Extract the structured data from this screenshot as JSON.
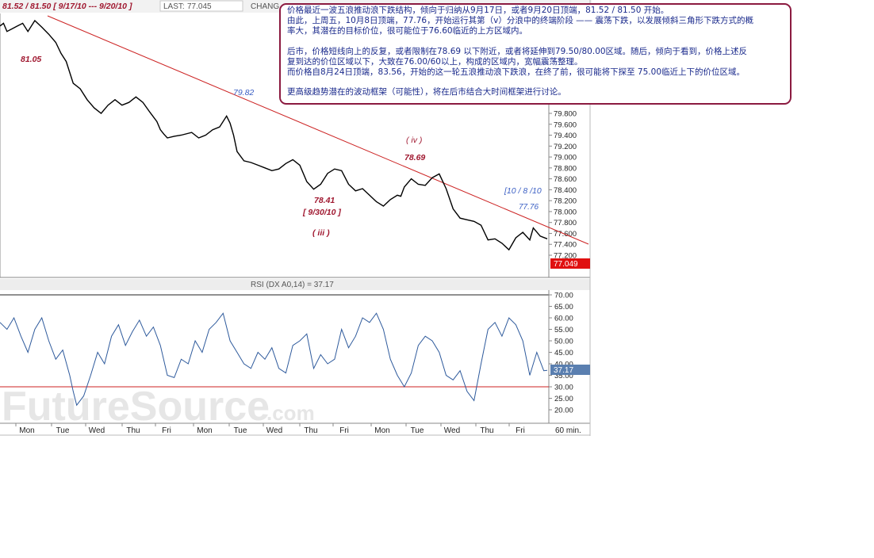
{
  "header": {
    "range_label": "81.52 / 81.50  [ 9/17/10 --- 9/20/10 ]",
    "last_label": "LAST:",
    "last_value": "77.045",
    "change_label": "CHANG"
  },
  "rsi_panel": {
    "label": "RSI (DX A0,14) = 37.17",
    "badge": "37.17"
  },
  "price_badge": "77.049",
  "watermark": {
    "main": "FutureSource",
    "suffix": ".com"
  },
  "annotations": {
    "a_81_05": "81.05",
    "a_79_82": "79.82",
    "a_iv": "( iv )",
    "a_78_69": "78.69",
    "a_78_41": "78.41",
    "a_9_30": "[ 9/30/10 ]",
    "a_iii": "( iii )",
    "a_10_8": "[10 / 8 /10",
    "a_77_76": "77.76"
  },
  "note": {
    "lines": [
      "价格最近一波五浪推动浪下跌结构，倾向于归纳从9月17日，或者9月20日顶端，81.52 / 81.50 开始。",
      "由此，上周五，10月8日顶端，77.76，开始运行其第（v）分浪中的终端阶段 —— 震荡下跌，以发展倾斜三角形下跌方式的概",
      "率大，其潜在的目标价位，很可能位于76.60临近的上方区域内。",
      "",
      "后市，价格短线向上的反复，或者限制在78.69 以下附近，或者将延伸到79.50/80.00区域。随后，倾向于看到，价格上述反",
      "复到达的价位区域以下，大致在76.00/60以上，构成的区域内，宽幅震荡整理。",
      "而价格自8月24日顶端，83.56，开始的这一轮五浪推动浪下跌浪，在终了前，很可能将下探至 75.00临近上下的价位区域。",
      "",
      "更高级趋势潜在的波动框架（可能性），将在后市结合大时间框架进行讨论。"
    ]
  },
  "colors": {
    "price_line": "#000000",
    "rsi_line": "#2e5a9c",
    "trend_line": "#cc2222",
    "rsi_ref_line": "#cc2222",
    "annotation_red": "#a01830",
    "annotation_blue": "#3b5fc4",
    "note_border": "#8b1a40",
    "note_text": "#1a2a8c",
    "price_badge_bg": "#e01010",
    "rsi_badge_bg": "#5a7fb0"
  },
  "chart_data": [
    {
      "type": "line",
      "name_hint": "price",
      "y_ticks": [
        "79.800",
        "79.600",
        "79.400",
        "79.200",
        "79.000",
        "78.800",
        "78.600",
        "78.400",
        "78.200",
        "78.000",
        "77.800",
        "77.600",
        "77.400",
        "77.200"
      ],
      "ylim": [
        77.0,
        81.6
      ],
      "x_ticks": [
        "Mon",
        "Tue",
        "Wed",
        "Thu",
        "Fri",
        "Mon",
        "Tue",
        "Wed",
        "Thu",
        "Fri",
        "Mon",
        "Tue",
        "Wed",
        "Thu",
        "Fri"
      ],
      "x_unit_label": "60 min.",
      "x": [
        0,
        0.1,
        0.2,
        0.35,
        0.5,
        0.65,
        0.8,
        1.0,
        1.2,
        1.4,
        1.6,
        1.75,
        1.9,
        2.0,
        2.1,
        2.3,
        2.5,
        2.7,
        2.9,
        3.1,
        3.3,
        3.5,
        3.7,
        3.9,
        4.1,
        4.3,
        4.5,
        4.6,
        4.7,
        4.8,
        5.0,
        5.2,
        5.5,
        5.7,
        5.9,
        6.1,
        6.3,
        6.5,
        6.6,
        6.7,
        6.8,
        7.0,
        7.2,
        7.4,
        7.6,
        7.8,
        8.0,
        8.2,
        8.4,
        8.6,
        8.8,
        9.0,
        9.2,
        9.4,
        9.6,
        9.8,
        10.0,
        10.2,
        10.4,
        10.6,
        10.8,
        11.0,
        11.2,
        11.4,
        11.5,
        11.6,
        11.8,
        12.0,
        12.2,
        12.4,
        12.6,
        12.8,
        13.0,
        13.2,
        13.4,
        13.6,
        13.8,
        14.0,
        14.2,
        14.4,
        14.6,
        14.8,
        15.0,
        15.2,
        15.3,
        15.5,
        15.7
      ],
      "values": [
        81.4,
        81.45,
        81.3,
        81.35,
        81.4,
        81.45,
        81.3,
        81.5,
        81.38,
        81.25,
        81.1,
        80.9,
        80.75,
        80.55,
        80.35,
        80.25,
        80.05,
        79.9,
        79.8,
        79.95,
        80.05,
        79.95,
        80.0,
        80.1,
        80.0,
        79.82,
        79.65,
        79.5,
        79.42,
        79.35,
        79.38,
        79.4,
        79.45,
        79.35,
        79.4,
        79.5,
        79.55,
        79.75,
        79.62,
        79.4,
        79.1,
        78.93,
        78.9,
        78.85,
        78.8,
        78.75,
        78.78,
        78.88,
        78.95,
        78.85,
        78.55,
        78.41,
        78.5,
        78.7,
        78.78,
        78.75,
        78.5,
        78.38,
        78.42,
        78.3,
        78.18,
        78.1,
        78.22,
        78.3,
        78.28,
        78.45,
        78.6,
        78.5,
        78.48,
        78.62,
        78.69,
        78.42,
        78.05,
        77.88,
        77.85,
        77.82,
        77.75,
        77.48,
        77.5,
        77.42,
        77.3,
        77.52,
        77.62,
        77.48,
        77.7,
        77.55,
        77.5,
        77.3,
        77.05
      ]
    },
    {
      "type": "line",
      "name_hint": "rsi",
      "y_ticks": [
        "70.00",
        "65.00",
        "60.00",
        "55.00",
        "50.00",
        "45.00",
        "40.00",
        "35.00",
        "30.00",
        "25.00",
        "20.00"
      ],
      "ylim": [
        17,
        72
      ],
      "reference_level": 30,
      "x": [
        0,
        0.2,
        0.4,
        0.6,
        0.8,
        1.0,
        1.2,
        1.4,
        1.6,
        1.8,
        2.0,
        2.1,
        2.2,
        2.4,
        2.6,
        2.8,
        3.0,
        3.2,
        3.4,
        3.6,
        3.8,
        4.0,
        4.2,
        4.4,
        4.6,
        4.8,
        5.0,
        5.2,
        5.4,
        5.6,
        5.8,
        6.0,
        6.2,
        6.4,
        6.6,
        6.8,
        7.0,
        7.2,
        7.4,
        7.6,
        7.8,
        8.0,
        8.2,
        8.4,
        8.6,
        8.8,
        9.0,
        9.2,
        9.4,
        9.6,
        9.8,
        10.0,
        10.2,
        10.4,
        10.6,
        10.8,
        11.0,
        11.2,
        11.4,
        11.6,
        11.8,
        12.0,
        12.2,
        12.4,
        12.6,
        12.8,
        13.0,
        13.2,
        13.4,
        13.6,
        13.8,
        14.0,
        14.2,
        14.4,
        14.6,
        14.8,
        15.0,
        15.2,
        15.4,
        15.6,
        15.7
      ],
      "values": [
        58,
        55,
        60,
        52,
        45,
        55,
        60,
        50,
        42,
        46,
        35,
        28,
        22,
        26,
        35,
        45,
        40,
        52,
        57,
        48,
        54,
        59,
        52,
        56,
        48,
        35,
        34,
        42,
        40,
        50,
        45,
        55,
        58,
        62,
        50,
        45,
        40,
        38,
        45,
        42,
        47,
        38,
        36,
        48,
        50,
        53,
        38,
        44,
        40,
        42,
        55,
        47,
        52,
        60,
        58,
        62,
        55,
        42,
        35,
        30,
        36,
        48,
        52,
        50,
        45,
        35,
        33,
        37,
        28,
        24,
        40,
        55,
        58,
        52,
        60,
        57,
        50,
        35,
        45,
        37,
        37.17
      ]
    }
  ]
}
